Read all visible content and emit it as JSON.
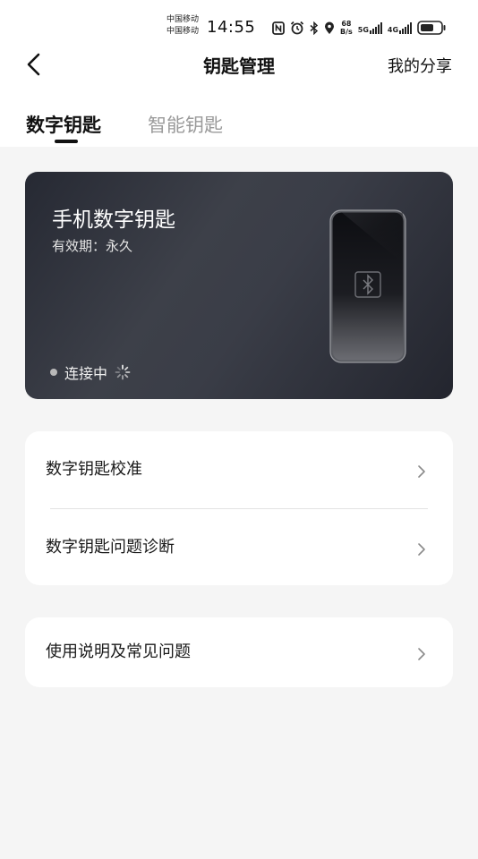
{
  "status_bar": {
    "carrier_1": "中国移动",
    "carrier_2": "中国移动",
    "time": "14:55",
    "net_speed_value": "68",
    "net_speed_unit": "B/s",
    "sim1_gen": "5G",
    "sim2_gen": "4G"
  },
  "header": {
    "title": "钥匙管理",
    "share_label": "我的分享"
  },
  "tabs": [
    {
      "label": "数字钥匙",
      "active": true
    },
    {
      "label": "智能钥匙",
      "active": false
    }
  ],
  "key_card": {
    "title": "手机数字钥匙",
    "validity": "有效期：永久",
    "status": "连接中"
  },
  "menu": {
    "group1": [
      {
        "label": "数字钥匙校准"
      },
      {
        "label": "数字钥匙问题诊断"
      }
    ],
    "group2": [
      {
        "label": "使用说明及常见问题"
      }
    ]
  },
  "colors": {
    "page_bg": "#f5f5f5",
    "card_bg": "#33363f",
    "text_primary": "#1a1a1a",
    "tab_inactive": "#9a9a9a"
  },
  "icons": [
    "nfc-icon",
    "alarm-icon",
    "bluetooth-icon",
    "location-icon",
    "signal-icon",
    "battery-icon",
    "back-arrow-icon",
    "chevron-right-icon",
    "loading-spinner-icon"
  ]
}
